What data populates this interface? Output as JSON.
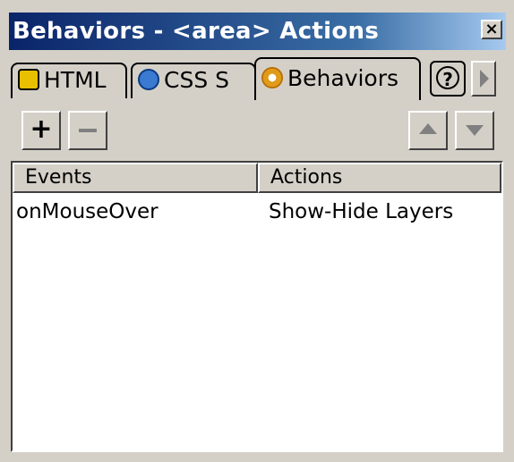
{
  "window": {
    "title": "Behaviors - <area> Actions",
    "close_glyph": "×"
  },
  "tabs": [
    {
      "label": "HTML",
      "icon": "html-tab-icon"
    },
    {
      "label": "CSS S",
      "icon": "css-tab-icon"
    },
    {
      "label": "Behaviors",
      "icon": "behaviors-gear-icon",
      "active": true
    }
  ],
  "tab_controls": {
    "help_glyph": "?"
  },
  "toolbar": {
    "add_glyph": "+"
  },
  "table": {
    "columns": [
      "Events",
      "Actions"
    ],
    "rows": [
      {
        "event": "onMouseOver",
        "action": "Show-Hide Layers"
      }
    ]
  },
  "colors": {
    "title_gradient_start": "#0a246a",
    "title_gradient_end": "#a6caf0",
    "face": "#d4d0c8"
  }
}
